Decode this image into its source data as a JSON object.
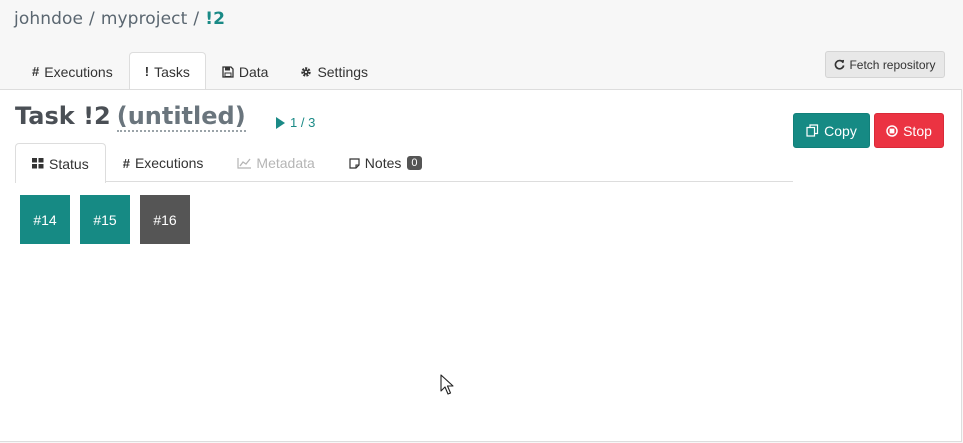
{
  "breadcrumb": {
    "user": "johndoe",
    "project": "myproject",
    "current": "!2",
    "separator": "/"
  },
  "project_tabs": [
    {
      "label": "Executions",
      "icon": "hash-icon",
      "glyph": "#",
      "active": false
    },
    {
      "label": "Tasks",
      "icon": "exclamation-icon",
      "glyph": "!",
      "active": true
    },
    {
      "label": "Data",
      "icon": "save-icon",
      "glyph": "",
      "active": false
    },
    {
      "label": "Settings",
      "icon": "gear-icon",
      "glyph": "",
      "active": false
    }
  ],
  "fetch_button": {
    "label": "Fetch repository",
    "icon": "refresh-icon"
  },
  "task": {
    "prefix": "Task !2",
    "name": "(untitled)",
    "progress": "1 / 3"
  },
  "actions": {
    "copy_label": "Copy",
    "stop_label": "Stop"
  },
  "sub_tabs": [
    {
      "label": "Status",
      "icon": "grid-icon",
      "active": true,
      "disabled": false
    },
    {
      "label": "Executions",
      "icon": "hash-icon",
      "active": false,
      "disabled": false
    },
    {
      "label": "Metadata",
      "icon": "line-chart-icon",
      "active": false,
      "disabled": true
    },
    {
      "label": "Notes",
      "icon": "note-icon",
      "badge": "0",
      "active": false,
      "disabled": false
    }
  ],
  "executions": [
    {
      "label": "#14",
      "status": "complete",
      "color": "#168a84"
    },
    {
      "label": "#15",
      "status": "complete",
      "color": "#168a84"
    },
    {
      "label": "#16",
      "status": "stopped",
      "color": "#555555"
    }
  ],
  "colors": {
    "accent": "#168a84",
    "danger": "#eb3342",
    "muted": "#555555"
  }
}
